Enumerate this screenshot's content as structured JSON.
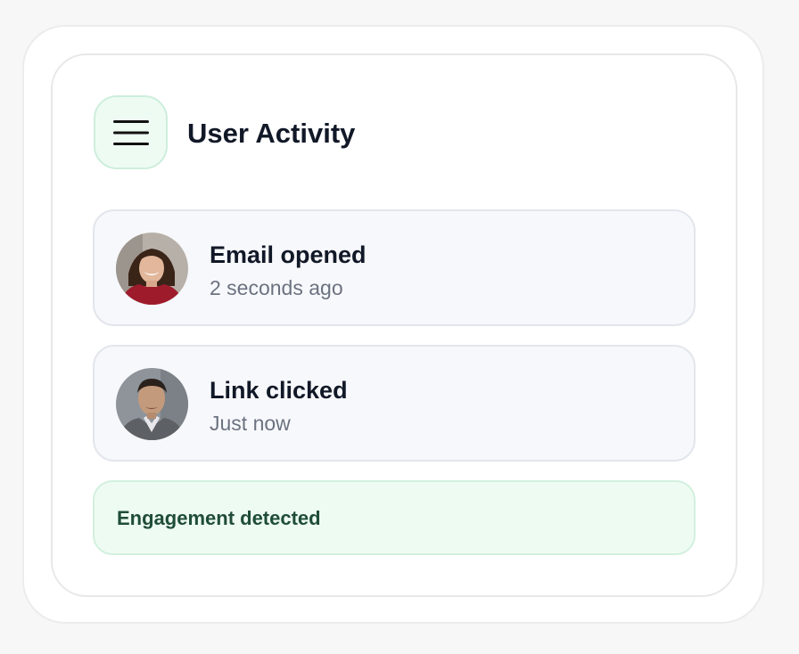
{
  "widget": {
    "title": "User Activity",
    "menu_icon": "hamburger-menu-icon"
  },
  "activities": [
    {
      "title": "Email opened",
      "time": "2 seconds ago",
      "avatar": "woman-red-sweater-avatar"
    },
    {
      "title": "Link clicked",
      "time": "Just now",
      "avatar": "man-gray-jacket-avatar"
    }
  ],
  "status": {
    "text": "Engagement detected"
  },
  "colors": {
    "accent_bg": "#eefbf3",
    "accent_text": "#1f4d37",
    "title_text": "#111827",
    "muted_text": "#6b7280",
    "card_bg": "#f7f8fb"
  }
}
